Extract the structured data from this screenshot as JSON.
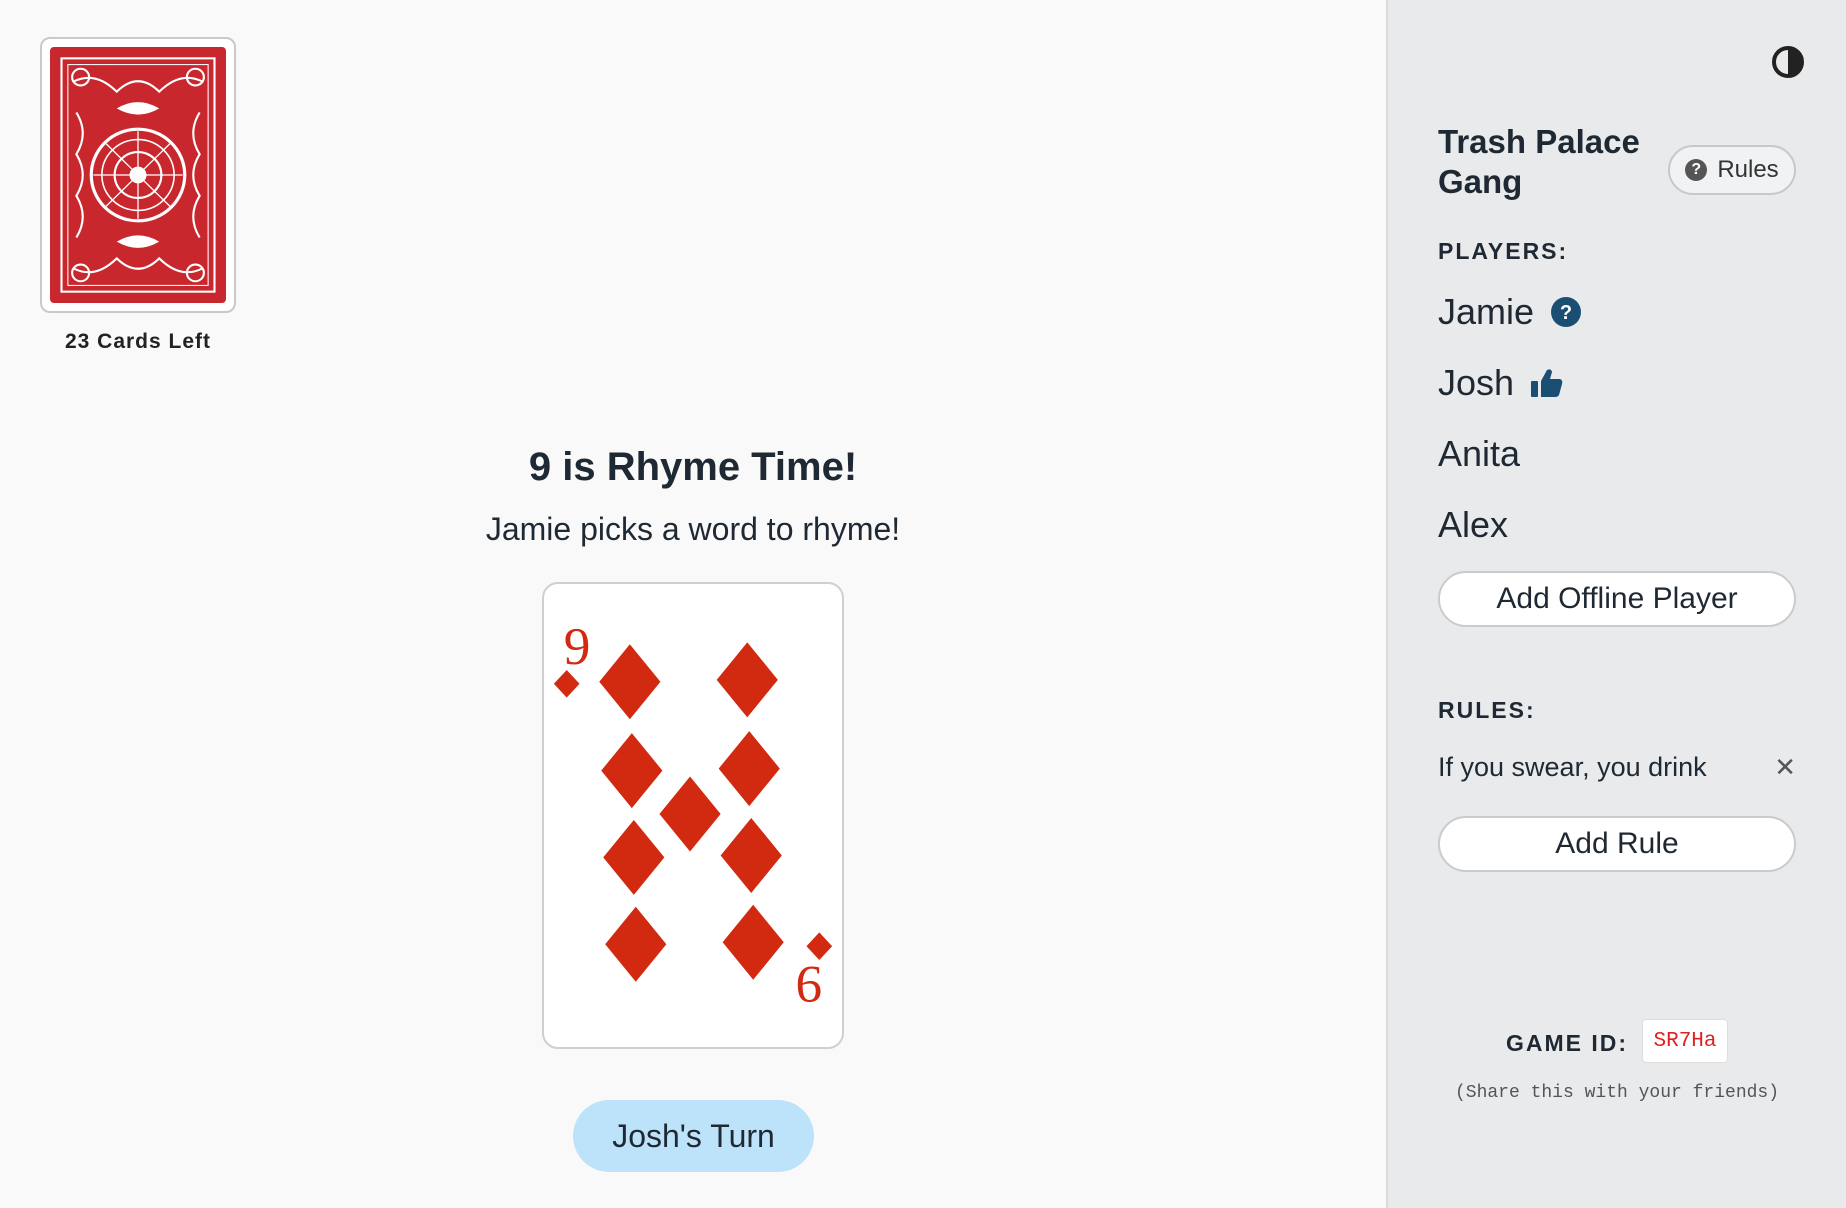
{
  "deck": {
    "cards_left": "23 Cards Left",
    "back_color": "#c8272d"
  },
  "current_card": {
    "rank": "9",
    "suit": "diamonds",
    "color": "#d22a10"
  },
  "headline": "9 is Rhyme Time!",
  "subline": "Jamie picks a word to rhyme!",
  "turn_button": "Josh's Turn",
  "sidebar": {
    "theme_toggle_icon": "contrast-icon",
    "group_name": "Trash Palace Gang",
    "rules_button": "Rules",
    "players_label": "PLAYERS:",
    "players": [
      {
        "name": "Jamie",
        "status_icon": "question-icon"
      },
      {
        "name": "Josh",
        "status_icon": "thumbs-up-icon"
      },
      {
        "name": "Anita"
      },
      {
        "name": "Alex"
      }
    ],
    "add_player_button": "Add Offline Player",
    "rules_label": "RULES:",
    "rules": [
      {
        "text": "If you swear, you drink"
      }
    ],
    "add_rule_button": "Add Rule",
    "game_id_label": "GAME ID:",
    "game_id": "SR7Ha",
    "share_note": "(Share this with your friends)"
  },
  "colors": {
    "accent_blue": "#1b4e73",
    "turn_button_bg": "#bde3fa",
    "game_id_text": "#e02020"
  }
}
